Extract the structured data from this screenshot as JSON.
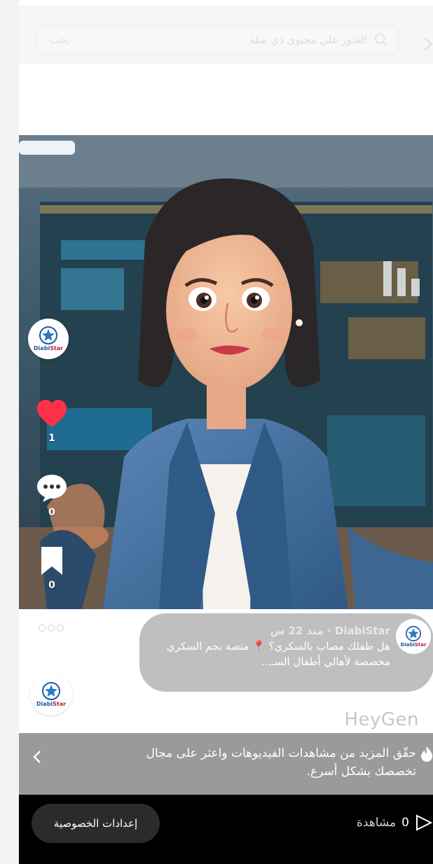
{
  "search": {
    "placeholder": "العثور على محتوى ذي صلة",
    "button_label": "بحث"
  },
  "channel": {
    "brand_part1": "Diabi",
    "brand_part2": "Star"
  },
  "actions": {
    "likes": "1",
    "comments": "0",
    "saves": "0"
  },
  "post": {
    "meta": "DiabiStar · منذ 22 س",
    "caption": "هل طفلك مصاب بالسكري؟ 📍 منصة نجم السكري مخصصة لأهالي أطفال السـ..."
  },
  "watermark": "HeyGen",
  "promo": {
    "text": "حقّق المزيد من مشاهدات الفيديوهات واعثر على مجال تخصصك بشكل أسرع."
  },
  "bottom": {
    "views_count": "0",
    "views_unit": "مشاهدة",
    "privacy_button": "إعدادات الخصوصية"
  },
  "colors": {
    "like_red": "#ff3148",
    "promo_gray": "#9a9a9a",
    "bottom_black": "#000000"
  },
  "icons": [
    "search-icon",
    "back-chevron-icon",
    "heart-icon",
    "comment-icon",
    "bookmark-icon",
    "more-icon",
    "fire-icon",
    "chevron-left-icon",
    "play-icon"
  ]
}
